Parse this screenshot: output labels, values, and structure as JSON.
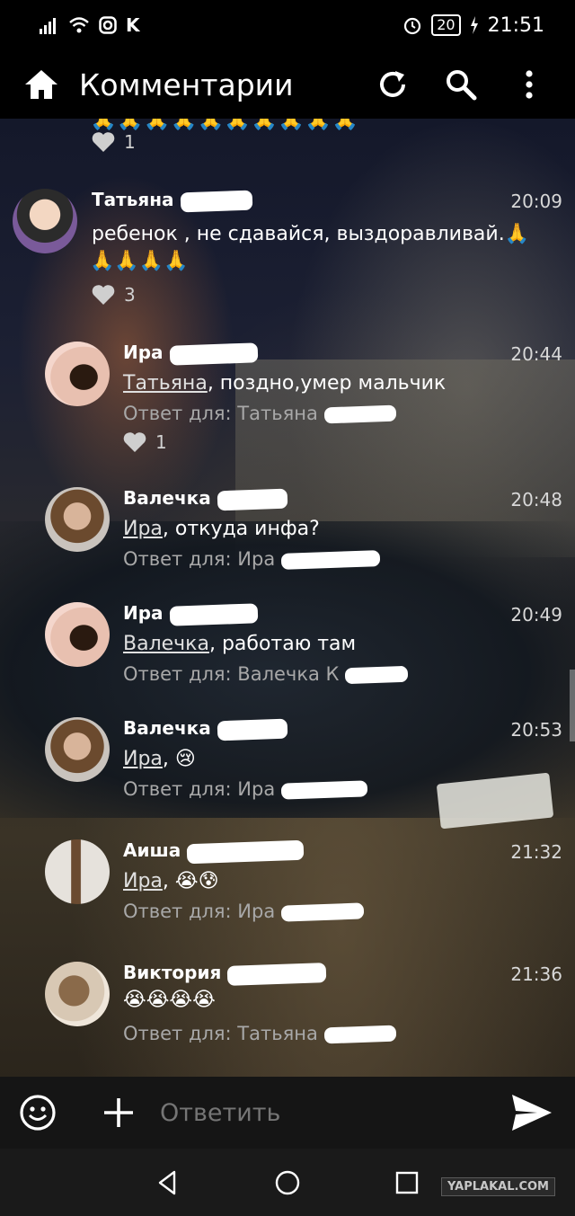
{
  "status_bar": {
    "left_icons": [
      "signal-icon",
      "wifi-icon",
      "instagram-icon",
      "vk-icon"
    ],
    "vk_letter": "K",
    "battery": "20",
    "time": "21:51"
  },
  "app_bar": {
    "title": "Комментарии"
  },
  "top_partial": {
    "likes": "1"
  },
  "comments": [
    {
      "name": "Татьяна",
      "time": "20:09",
      "text_line1": "ребенок , не сдавайся, выздоравливай.🙏",
      "text_line2": "🙏🙏🙏🙏",
      "likes": "3"
    },
    {
      "name": "Ира",
      "time": "20:44",
      "mention": "Татьяна",
      "text": ", поздно,умер мальчик",
      "reply": "Ответ для: Татьяна",
      "likes": "1"
    },
    {
      "name": "Валечка",
      "time": "20:48",
      "mention": "Ира",
      "text": ", откуда инфа?",
      "reply": "Ответ для: Ира"
    },
    {
      "name": "Ира",
      "time": "20:49",
      "mention": "Валечка",
      "text": ", работаю там",
      "reply": "Ответ для: Валечка К"
    },
    {
      "name": "Валечка",
      "time": "20:53",
      "mention": "Ира",
      "text": ", 😢",
      "reply": "Ответ для: Ира"
    },
    {
      "name": "Аиша",
      "time": "21:32",
      "mention": "Ира",
      "text": ", 😭😰",
      "reply": "Ответ для: Ира"
    },
    {
      "name": "Виктория",
      "time": "21:36",
      "text": "😭😭😭😭",
      "reply": "Ответ для: Татьяна"
    }
  ],
  "input": {
    "placeholder": "Ответить"
  },
  "watermark": "YAPLAKAL.COM"
}
